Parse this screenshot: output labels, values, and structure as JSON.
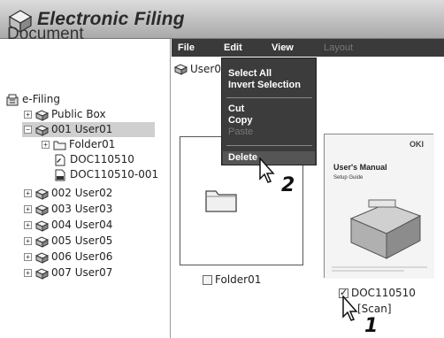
{
  "app": {
    "title": "Electronic Filing"
  },
  "left": {
    "heading": "Document",
    "tree": [
      {
        "label": "e-Filing",
        "icon": "efiling-icon"
      },
      {
        "label": "Public Box",
        "icon": "box-icon"
      },
      {
        "label": "001 User01",
        "icon": "box-icon"
      },
      {
        "label": "Folder01",
        "icon": "folder-icon"
      },
      {
        "label": "DOC110510",
        "icon": "document-icon"
      },
      {
        "label": "DOC110510-001",
        "icon": "document-icon"
      },
      {
        "label": "002 User02",
        "icon": "box-icon"
      },
      {
        "label": "003 User03",
        "icon": "box-icon"
      },
      {
        "label": "004 User04",
        "icon": "box-icon"
      },
      {
        "label": "005 User05",
        "icon": "box-icon"
      },
      {
        "label": "006 User06",
        "icon": "box-icon"
      },
      {
        "label": "007 User07",
        "icon": "box-icon"
      }
    ]
  },
  "menubar": {
    "file": "File",
    "edit": "Edit",
    "view": "View",
    "layout": "Layout"
  },
  "breadcrumb": {
    "label": "User0"
  },
  "dropdown": {
    "select_all": "Select All",
    "invert_selection": "Invert Selection",
    "cut": "Cut",
    "copy": "Copy",
    "paste": "Paste",
    "delete": "Delete"
  },
  "items": {
    "folder": {
      "label": "Folder01",
      "checked": false
    },
    "document": {
      "label": "DOC110510",
      "sublabel": "[Scan]",
      "checked": true
    }
  },
  "thumbnail": {
    "brand": "OKI",
    "title": "User's Manual",
    "subtitle": "Setup Guide"
  },
  "steps": {
    "one": "1",
    "two": "2"
  }
}
